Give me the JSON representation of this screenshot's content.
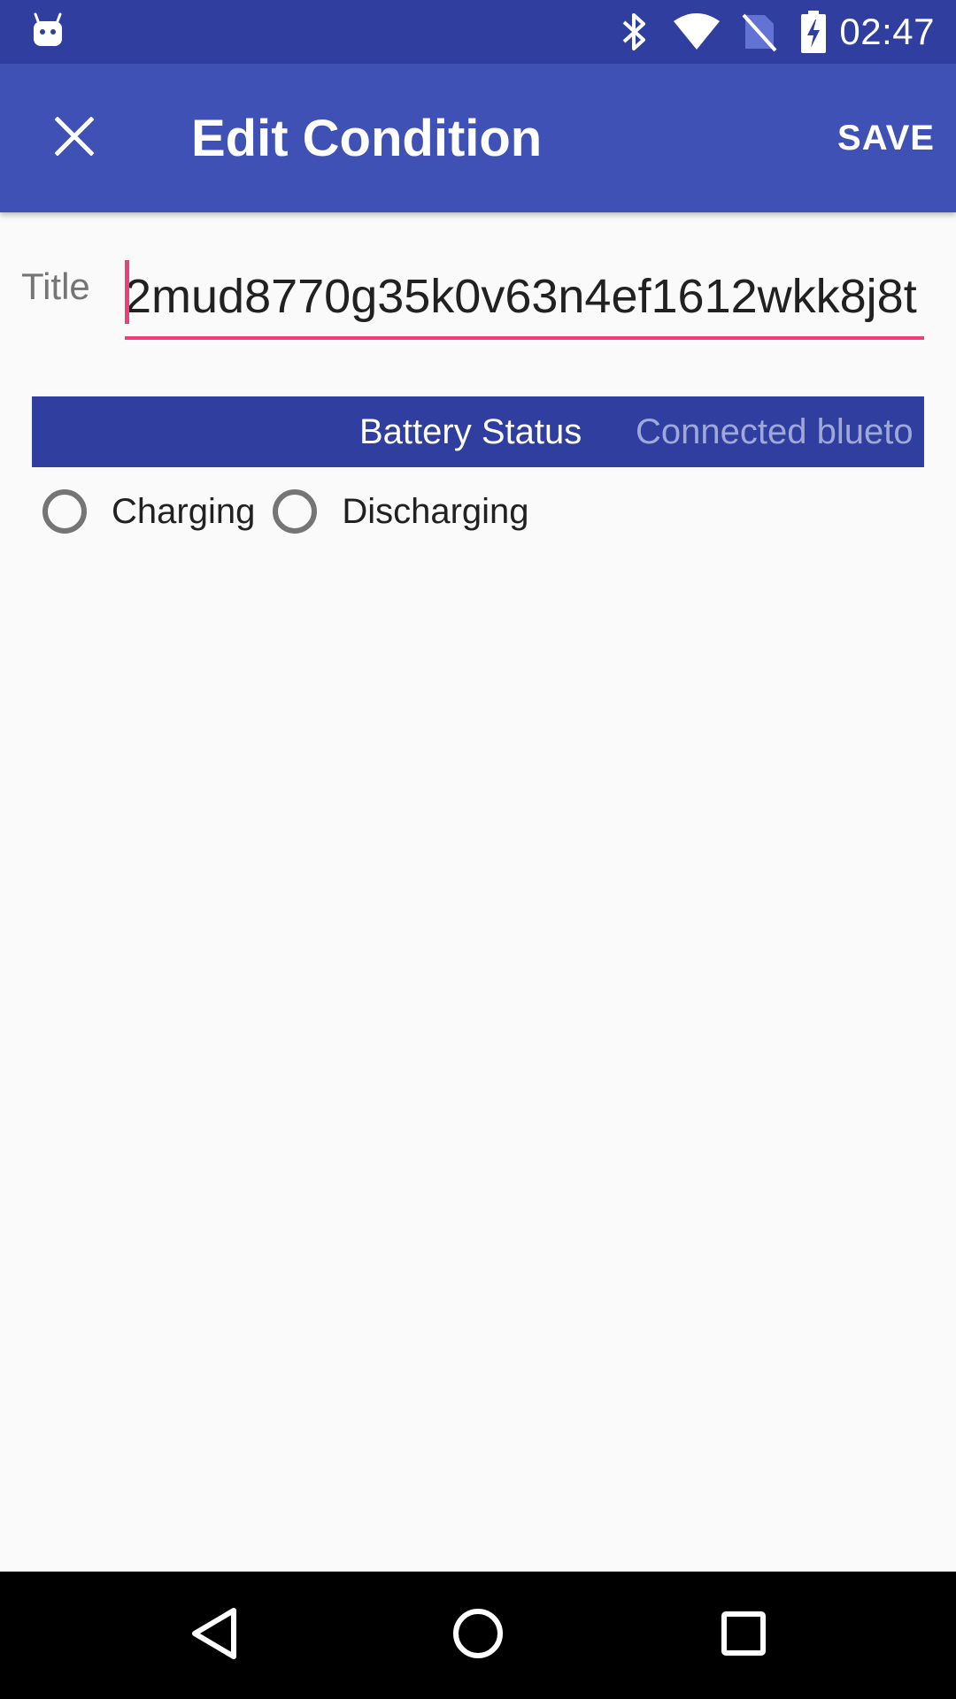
{
  "status_bar": {
    "time": "02:47",
    "icons": [
      "android-debug-icon",
      "bluetooth-icon",
      "wifi-icon",
      "no-sim-icon",
      "battery-charging-icon"
    ]
  },
  "app_bar": {
    "title": "Edit Condition",
    "save_label": "SAVE",
    "close_icon": "close-icon"
  },
  "form": {
    "title_label": "Title",
    "title_value": "2mud8770g35k0v63n4ef1612wkk8j8t"
  },
  "tabs": [
    {
      "label": "Battery Status",
      "active": true
    },
    {
      "label": "Connected blueto",
      "active": false
    }
  ],
  "radio_options": [
    {
      "label": "Charging",
      "checked": false
    },
    {
      "label": "Discharging",
      "checked": false
    }
  ],
  "nav_bar": {
    "icons": [
      "back-icon",
      "home-icon",
      "recents-icon"
    ]
  },
  "colors": {
    "status_bar": "#303f9f",
    "app_bar": "#3f51b5",
    "accent": "#ec407a",
    "tab_bg": "#303f9f"
  }
}
